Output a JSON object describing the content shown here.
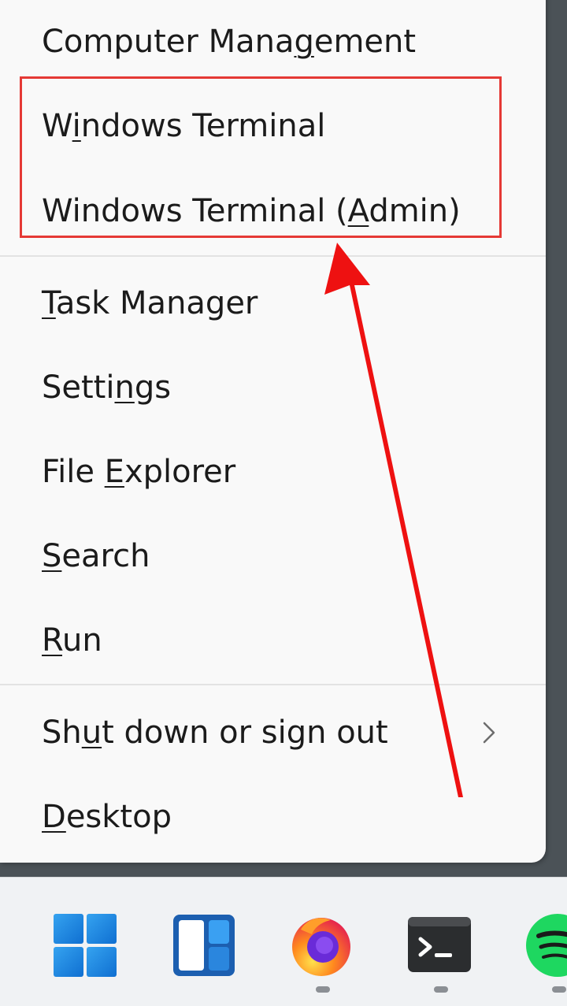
{
  "menu": {
    "items": [
      {
        "id": "computer-management",
        "pre": "Computer Mana",
        "ul": "g",
        "post": "ement"
      },
      {
        "id": "windows-terminal",
        "pre": "W",
        "ul": "i",
        "post": "ndows Terminal"
      },
      {
        "id": "windows-terminal-admin",
        "pre": "Windows Terminal (",
        "ul": "A",
        "post": "dmin)"
      },
      {
        "id": "task-manager",
        "pre": "",
        "ul": "T",
        "post": "ask Manager"
      },
      {
        "id": "settings",
        "pre": "Setti",
        "ul": "n",
        "post": "gs"
      },
      {
        "id": "file-explorer",
        "pre": "File ",
        "ul": "E",
        "post": "xplorer"
      },
      {
        "id": "search",
        "pre": "",
        "ul": "S",
        "post": "earch"
      },
      {
        "id": "run",
        "pre": "",
        "ul": "R",
        "post": "un"
      },
      {
        "id": "shut-down-or-sign-out",
        "pre": "Sh",
        "ul": "u",
        "post": "t down or sign out"
      },
      {
        "id": "desktop",
        "pre": "",
        "ul": "D",
        "post": "esktop"
      }
    ]
  },
  "taskbar": {
    "icons": [
      "windows-start-icon",
      "widgets-icon",
      "firefox-icon",
      "terminal-icon",
      "spotify-icon"
    ]
  },
  "colors": {
    "highlight": "#e53935",
    "arrow": "#ee1111",
    "menu_bg": "#f9f9f9",
    "taskbar_bg": "#f0f2f4"
  }
}
